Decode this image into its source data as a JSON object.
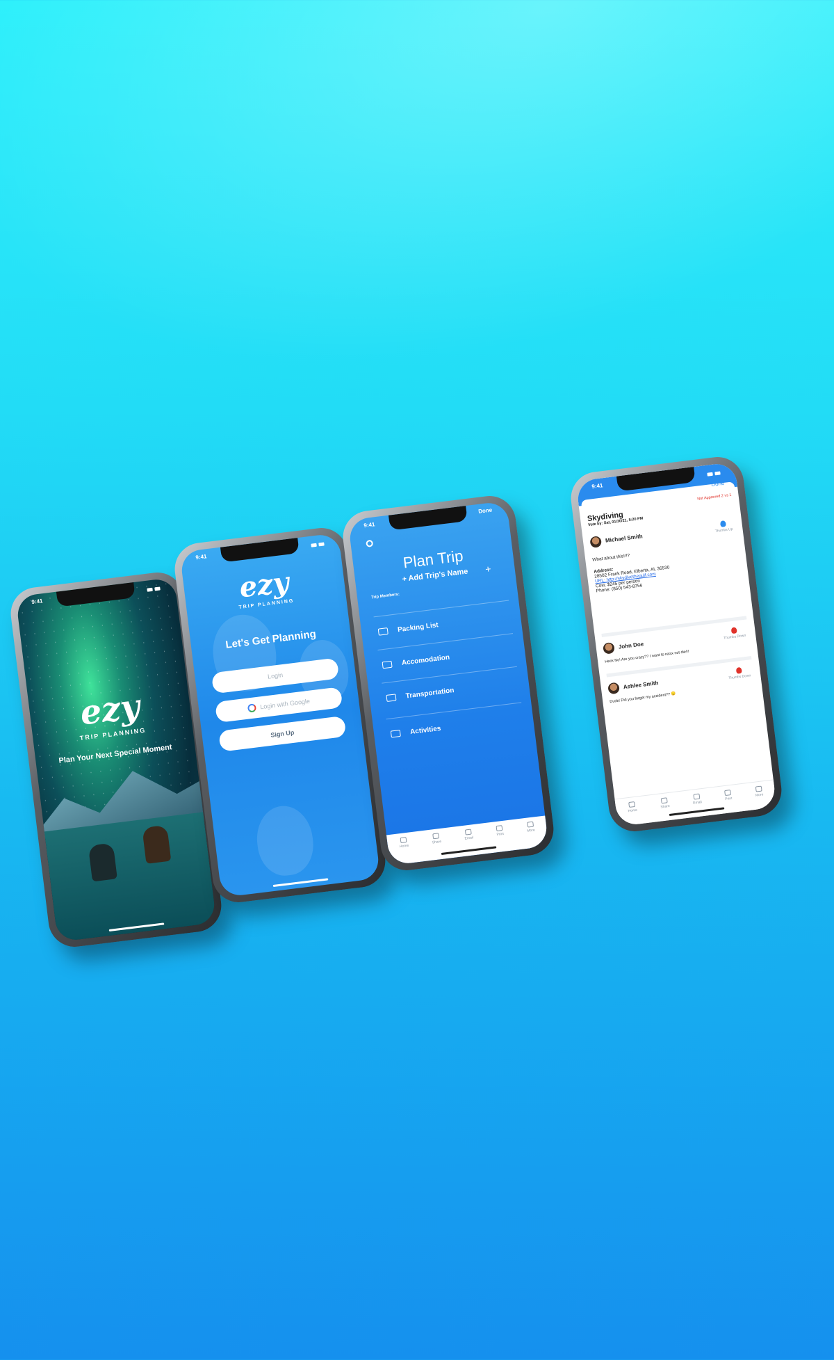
{
  "status_time": "9:41",
  "phone1": {
    "logo": "ezy",
    "subtitle": "TRIP PLANNING",
    "tagline": "Plan Your Next Special Moment"
  },
  "phone2": {
    "logo": "ezy",
    "subtitle": "TRIP PLANNING",
    "heading": "Let's Get Planning",
    "login_label": "Login",
    "google_label": "Login with Google",
    "signup_label": "Sign Up"
  },
  "phone3": {
    "done_label": "Done",
    "title": "Plan Trip",
    "add_name": "+ Add Trip's Name",
    "add_plus": "+",
    "members_label": "Trip Members:",
    "menu": [
      {
        "label": "Packing List",
        "icon": "suitcase-icon"
      },
      {
        "label": "Accomodation",
        "icon": "bed-icon"
      },
      {
        "label": "Transportation",
        "icon": "bus-icon"
      },
      {
        "label": "Activities",
        "icon": "activity-icon"
      }
    ],
    "tabs": [
      {
        "label": "Home",
        "icon": "home-icon"
      },
      {
        "label": "Share",
        "icon": "share-icon"
      },
      {
        "label": "Email",
        "icon": "mail-icon"
      },
      {
        "label": "Print",
        "icon": "print-icon"
      },
      {
        "label": "More",
        "icon": "bell-icon"
      }
    ]
  },
  "phone4": {
    "done_label": "Done",
    "title": "Skydiving",
    "vote_by": "Vote by: Sat, 01/30/21, 5:20 PM",
    "status": "Not Approved 2 vs 1",
    "comments": [
      {
        "name": "Michael Smith",
        "vote": "Thumbs Up",
        "lines": [
          "What about this!!!?",
          "Address:",
          "28502 Frank Road, Elberta, AL 36530",
          "URL: http://skydivethegulf.com",
          "Cost: $245 per person",
          "Phone: (850) 543-8756"
        ]
      },
      {
        "name": "John Doe",
        "vote": "Thumbs Down",
        "lines": [
          "Heck No! Are you crazy?? I want to relax not die!!!"
        ]
      },
      {
        "name": "Ashlee Smith",
        "vote": "Thumbs Down",
        "lines": [
          "Dude! Did you forget my accident?? 😞"
        ]
      }
    ],
    "tabs": [
      {
        "label": "Home",
        "icon": "home-icon"
      },
      {
        "label": "Share",
        "icon": "share-icon"
      },
      {
        "label": "Email",
        "icon": "mail-icon"
      },
      {
        "label": "Print",
        "icon": "print-icon"
      },
      {
        "label": "More",
        "icon": "bell-icon"
      }
    ]
  },
  "colors": {
    "background_top": "#2ff0fb",
    "background_bottom": "#1590ee",
    "app_blue": "#1f7fea",
    "thumbs_up": "#2a8bee",
    "thumbs_down": "#e0322a"
  }
}
